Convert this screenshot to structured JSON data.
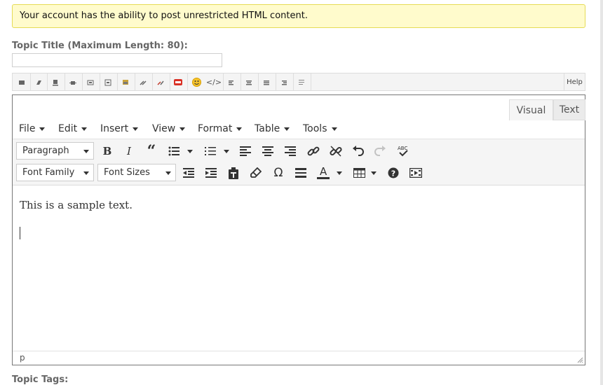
{
  "notice": {
    "text": "Your account has the ability to post unrestricted HTML content."
  },
  "topic_title": {
    "label": "Topic Title (Maximum Length: 80):",
    "value": ""
  },
  "quicktags": {
    "help_label": "Help"
  },
  "editor": {
    "tabs": {
      "visual": "Visual",
      "text": "Text"
    },
    "menu": [
      "File",
      "Edit",
      "Insert",
      "View",
      "Format",
      "Table",
      "Tools"
    ],
    "format_select": "Paragraph",
    "font_family_select": "Font Family",
    "font_size_select": "Font Sizes",
    "content_text": "This is a sample text.",
    "status_path": "p",
    "toolbar_row1_icons": [
      "bold-icon",
      "italic-icon",
      "blockquote-icon",
      "bullet-list-icon",
      "numbered-list-icon",
      "align-left-icon",
      "align-center-icon",
      "align-right-icon",
      "link-icon",
      "unlink-icon",
      "undo-icon",
      "redo-icon",
      "spellcheck-icon"
    ],
    "toolbar_row2_icons": [
      "outdent-icon",
      "indent-icon",
      "paste-text-icon",
      "clear-formatting-icon",
      "special-character-icon",
      "horizontal-line-icon",
      "text-color-icon",
      "table-icon",
      "help-icon",
      "media-icon"
    ]
  },
  "topic_tags": {
    "label": "Topic Tags:"
  }
}
